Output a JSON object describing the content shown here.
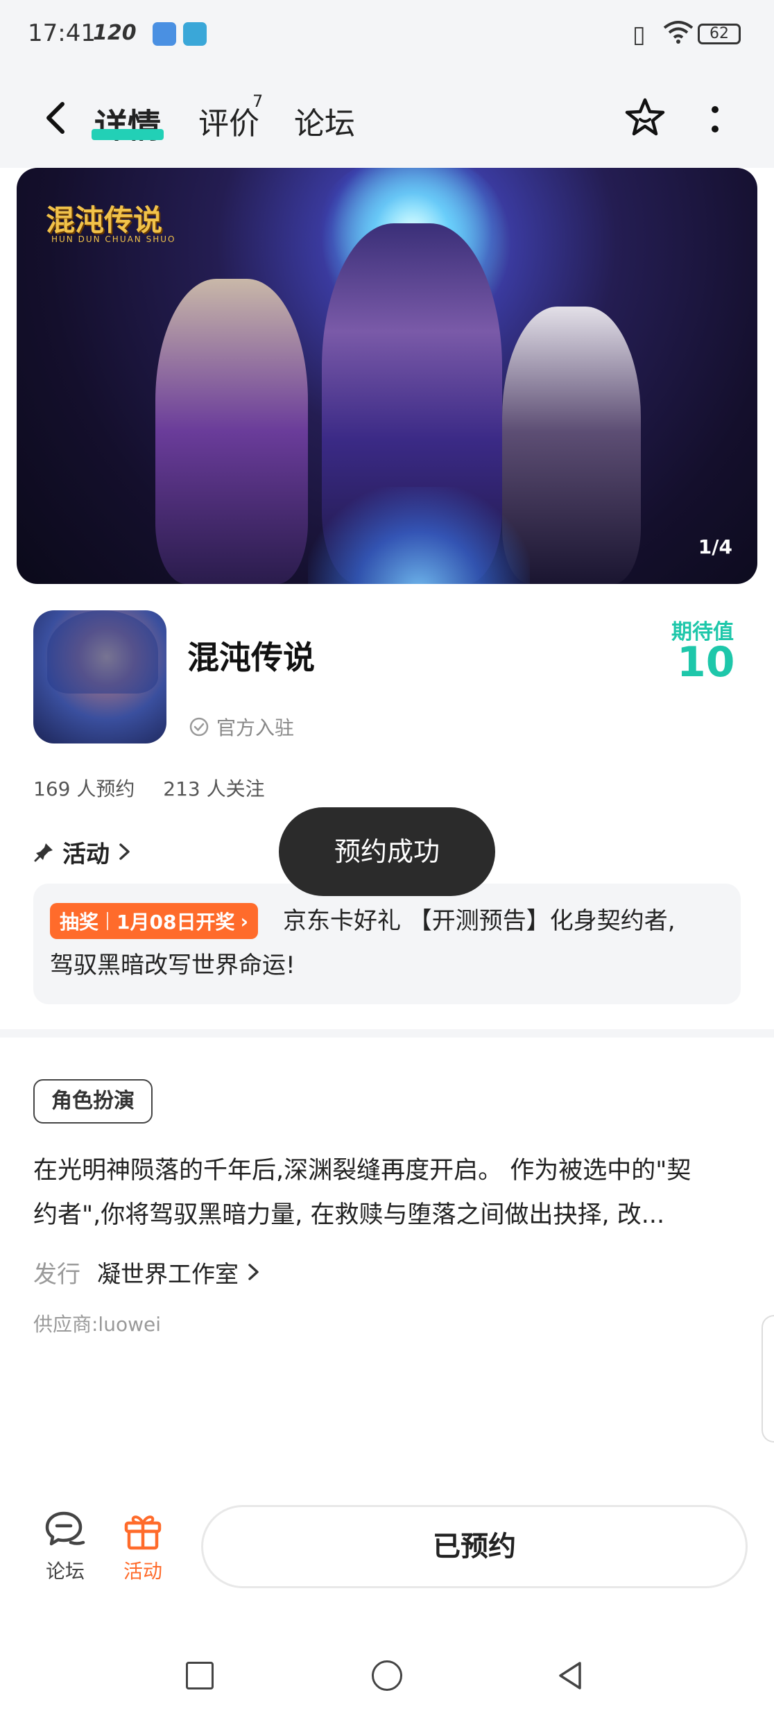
{
  "status_bar": {
    "time": "17:41",
    "refresh_rate": "120",
    "battery": "62"
  },
  "nav": {
    "tabs": [
      "详情",
      "评价",
      "论坛"
    ],
    "review_count": "7",
    "accent_color": "#22d0b6"
  },
  "banner": {
    "logo_text": "混沌传说",
    "logo_subtext": "HUN DUN CHUAN SHUO",
    "page_indicator": "1/4"
  },
  "game": {
    "title": "混沌传说",
    "official_badge": "官方入驻",
    "expectation_label": "期待值",
    "expectation_value": "10",
    "reservations": "169 人预约",
    "followers": "213 人关注"
  },
  "activity": {
    "title": "活动",
    "tag_type": "抽奖",
    "tag_date": "1月08日开奖",
    "text_line1": "京东卡好礼 【开测预告】化身契约者,",
    "text_line2": "驾驭黑暗改写世界命运!",
    "tag_color": "#ff6b2b"
  },
  "toast": {
    "message": "预约成功"
  },
  "details": {
    "genre": "角色扮演",
    "description_line1": "在光明神陨落的千年后,深渊裂缝再度开启。 作为被选中的\"契",
    "description_line2": "约者\",你将驾驭黑暗力量, 在救赎与堕落之间做出抉择, 改...",
    "publisher_label": "发行",
    "publisher_name": "凝世界工作室",
    "supplier": "供应商:luowei"
  },
  "bottom_bar": {
    "forum_label": "论坛",
    "activity_label": "活动",
    "reserved_button": "已预约"
  }
}
